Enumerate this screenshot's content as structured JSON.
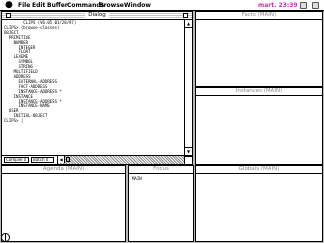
{
  "menubar": {
    "apple_symbol": "",
    "items": [
      "File",
      "Edit",
      "Buffer",
      "Commands",
      "Browse",
      "Window"
    ],
    "clock": "mart. 23:39"
  },
  "dialog": {
    "title": "Dialog",
    "console_lines": [
      "        CLIPS (V6.05 01/28/97)",
      "CLIPS> (browse-classes)",
      "OBJECT",
      "  PRIMITIVE",
      "    NUMBER",
      "      INTEGER",
      "      FLOAT",
      "    LEXEME",
      "      SYMBOL",
      "      STRING",
      "    MULTIFIELD",
      "    ADDRESS",
      "      EXTERNAL-ADDRESS",
      "      FACT-ADDRESS",
      "      INSTANCE-ADDRESS *",
      "    INSTANCE",
      "      INSTANCE-ADDRESS *",
      "      INSTANCE-NAME",
      "  USER",
      "    INITIAL-OBJECT",
      "CLIPS> |"
    ],
    "status": {
      "compile": "Compile  0",
      "batch": "Batch  0"
    }
  },
  "facts": {
    "title": "Facts (MAIN)"
  },
  "instances": {
    "title": "Instances (MAIN)"
  },
  "agenda": {
    "title": "Agenda (MAIN)"
  },
  "focus": {
    "title": "Focus",
    "items": [
      "MAIN"
    ]
  },
  "globals": {
    "title": "Globals (MAIN)"
  },
  "icons": {
    "apple": "apple-icon",
    "close": "close-box-icon",
    "zoom": "zoom-box-icon",
    "busy": "watch-cursor-icon"
  }
}
